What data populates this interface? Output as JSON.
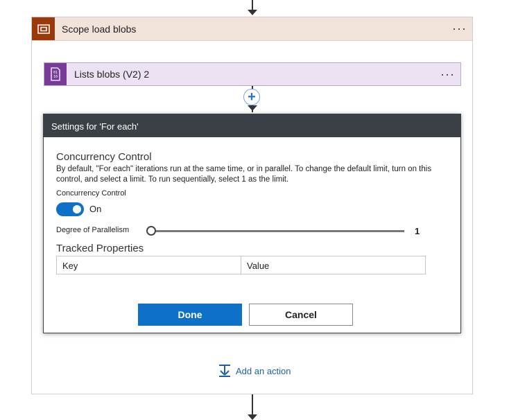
{
  "scope": {
    "title": "Scope load blobs",
    "menu": "···"
  },
  "list_blobs": {
    "title": "Lists blobs (V2) 2",
    "menu": "···"
  },
  "add_step": {
    "label": "+"
  },
  "settings": {
    "title": "Settings for 'For each'",
    "concurrency": {
      "heading": "Concurrency Control",
      "description": "By default, \"For each\" iterations run at the same time, or in parallel. To change the default limit, turn on this control, and select a limit. To run sequentially, select 1 as the limit.",
      "toggle_label": "Concurrency Control",
      "toggle_state": "On",
      "toggle_on": true,
      "parallelism_label": "Degree of Parallelism",
      "parallelism_value": "1"
    },
    "tracked": {
      "heading": "Tracked Properties",
      "key_placeholder": "Key",
      "value_placeholder": "Value"
    },
    "done_label": "Done",
    "cancel_label": "Cancel"
  },
  "add_action": {
    "label": "Add an action"
  },
  "colors": {
    "scope_accent": "#9a3a0a",
    "scope_header_bg": "#f2e3da",
    "blob_accent": "#7a3a9a",
    "blob_bg": "#ece2f4",
    "dialog_header": "#3b4047",
    "primary": "#0f70c8",
    "link": "#1e5fa8"
  }
}
